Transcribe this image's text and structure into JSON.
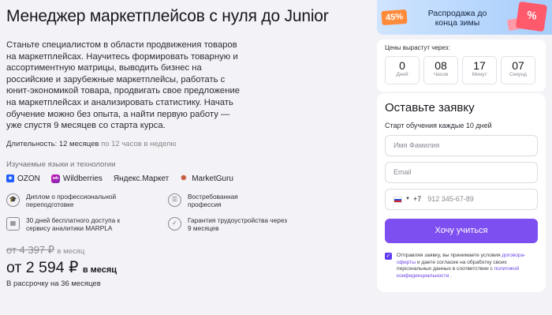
{
  "course": {
    "title": "Менеджер маркетплейсов с нуля до Junior",
    "description": "Станьте специалистом в области продвижения товаров на маркетплейсах. Научитесь формировать товарную и ассортиментную матрицы, выводить бизнес на российские и зарубежные маркетплейсы, работать с юнит-экономикой товара, продвигать свое предложение на маркетплейсах и анализировать статистику. Начать обучение можно без опыта, а найти первую работу — уже спустя 9 месяцев со старта курса.",
    "duration_label": "Длительность: 12 месяцев",
    "duration_note": "по 12 часов в неделю",
    "tech_title": "Изучаемые языки и технологии",
    "technologies": [
      {
        "name": "OZON",
        "icon": "ozon-logo"
      },
      {
        "name": "Wildberries",
        "icon": "wildberries-logo"
      },
      {
        "name": "Яндекс.Маркет",
        "icon": "none"
      },
      {
        "name": "MarketGuru",
        "icon": "marketguru-logo"
      }
    ],
    "features": [
      {
        "text": "Диплом о профессиональной переподготовке",
        "icon": "education-icon"
      },
      {
        "text": "Востребованная профессия",
        "icon": "list-icon"
      },
      {
        "text": "30 дней бесплатного доступа к сервису аналитики MARPLA",
        "icon": "calendar-icon"
      },
      {
        "text": "Гарантия трудоустройства через 9 месяцев",
        "icon": "shield-icon"
      }
    ],
    "old_price": "от 4 397 ₽",
    "old_price_unit": "в месяц",
    "new_price": "от 2 594 ₽",
    "new_price_unit": "в месяц",
    "installment": "В рассрочку на 36 месяцев"
  },
  "promo": {
    "badge": "45%",
    "text": "Распродажа до конца зимы"
  },
  "countdown": {
    "title": "Цены вырастут через:",
    "units": [
      {
        "value": "0",
        "label": "Дней"
      },
      {
        "value": "08",
        "label": "Часов"
      },
      {
        "value": "17",
        "label": "Минут"
      },
      {
        "value": "07",
        "label": "Секунд"
      }
    ]
  },
  "form": {
    "title": "Оставьте заявку",
    "subtitle": "Старт обучения каждые 10 дней",
    "name_placeholder": "Имя Фамилия",
    "email_placeholder": "Email",
    "phone_code": "+7",
    "phone_placeholder": "912 345-67-89",
    "submit_label": "Хочу учиться",
    "consent_text_1": "Отправляя заявку, вы принимаете условия",
    "consent_link_1": "договора-оферты",
    "consent_text_2": "и даете согласие на обработку своих персональных данных в соответствии с",
    "consent_link_2": "политикой конфиденциальности",
    "consent_text_3": ".",
    "accent_color": "#7e4ff0"
  }
}
